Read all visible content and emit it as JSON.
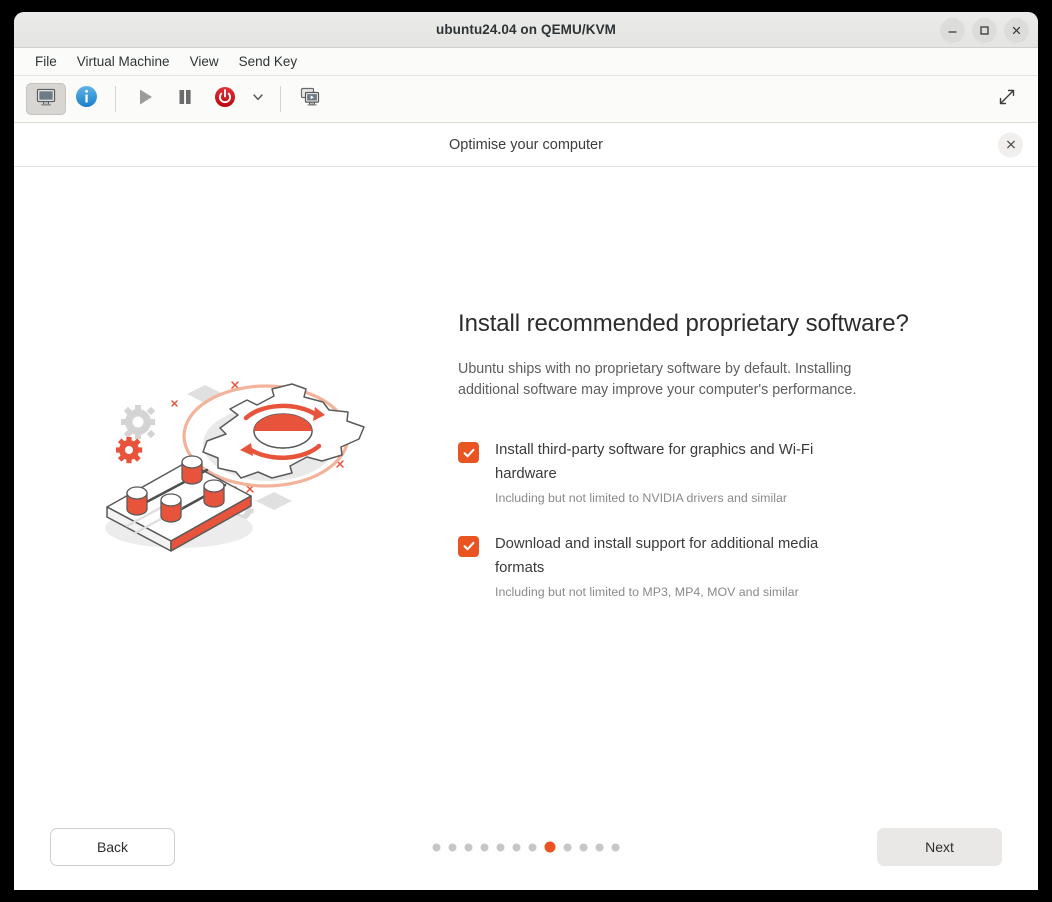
{
  "window": {
    "title": "ubuntu24.04 on QEMU/KVM",
    "controls": [
      {
        "name": "minimize-button",
        "icon": "minimize-icon",
        "label": "Minimize"
      },
      {
        "name": "maximize-button",
        "icon": "maximize-icon",
        "label": "Maximize"
      },
      {
        "name": "close-button",
        "icon": "close-icon",
        "label": "Close"
      }
    ]
  },
  "menubar": {
    "items": [
      {
        "label": "File"
      },
      {
        "label": "Virtual Machine"
      },
      {
        "label": "View"
      },
      {
        "label": "Send Key"
      }
    ]
  },
  "toolbar": {
    "buttons": [
      {
        "name": "show-console-button",
        "icon": "monitor-icon",
        "active": true
      },
      {
        "name": "show-details-button",
        "icon": "info-icon",
        "active": false
      },
      {
        "name": "run-button",
        "icon": "play-icon",
        "active": false
      },
      {
        "name": "pause-button",
        "icon": "pause-icon",
        "active": false
      },
      {
        "name": "shutdown-button",
        "icon": "power-icon",
        "active": false
      },
      {
        "name": "shutdown-options-button",
        "icon": "chevron-down-icon",
        "active": false
      },
      {
        "name": "snapshots-button",
        "icon": "snapshots-icon",
        "active": false
      }
    ],
    "fullscreen": {
      "name": "fullscreen-button",
      "icon": "expand-arrows-icon"
    }
  },
  "installer": {
    "header_title": "Optimise your computer",
    "close_label": "×",
    "heading": "Install recommended proprietary software?",
    "description": "Ubuntu ships with no proprietary software by default. Installing additional software may improve your computer's performance.",
    "options": [
      {
        "label": "Install third-party software for graphics and Wi-Fi hardware",
        "sublabel": "Including but not limited to NVIDIA drivers and similar",
        "checked": true
      },
      {
        "label": "Download and install support for additional media formats",
        "sublabel": "Including but not limited to MP3, MP4, MOV and similar",
        "checked": true
      }
    ],
    "footer": {
      "back_label": "Back",
      "next_label": "Next",
      "total_steps": 12,
      "current_step": 8
    },
    "accent_color": "#E95420"
  }
}
